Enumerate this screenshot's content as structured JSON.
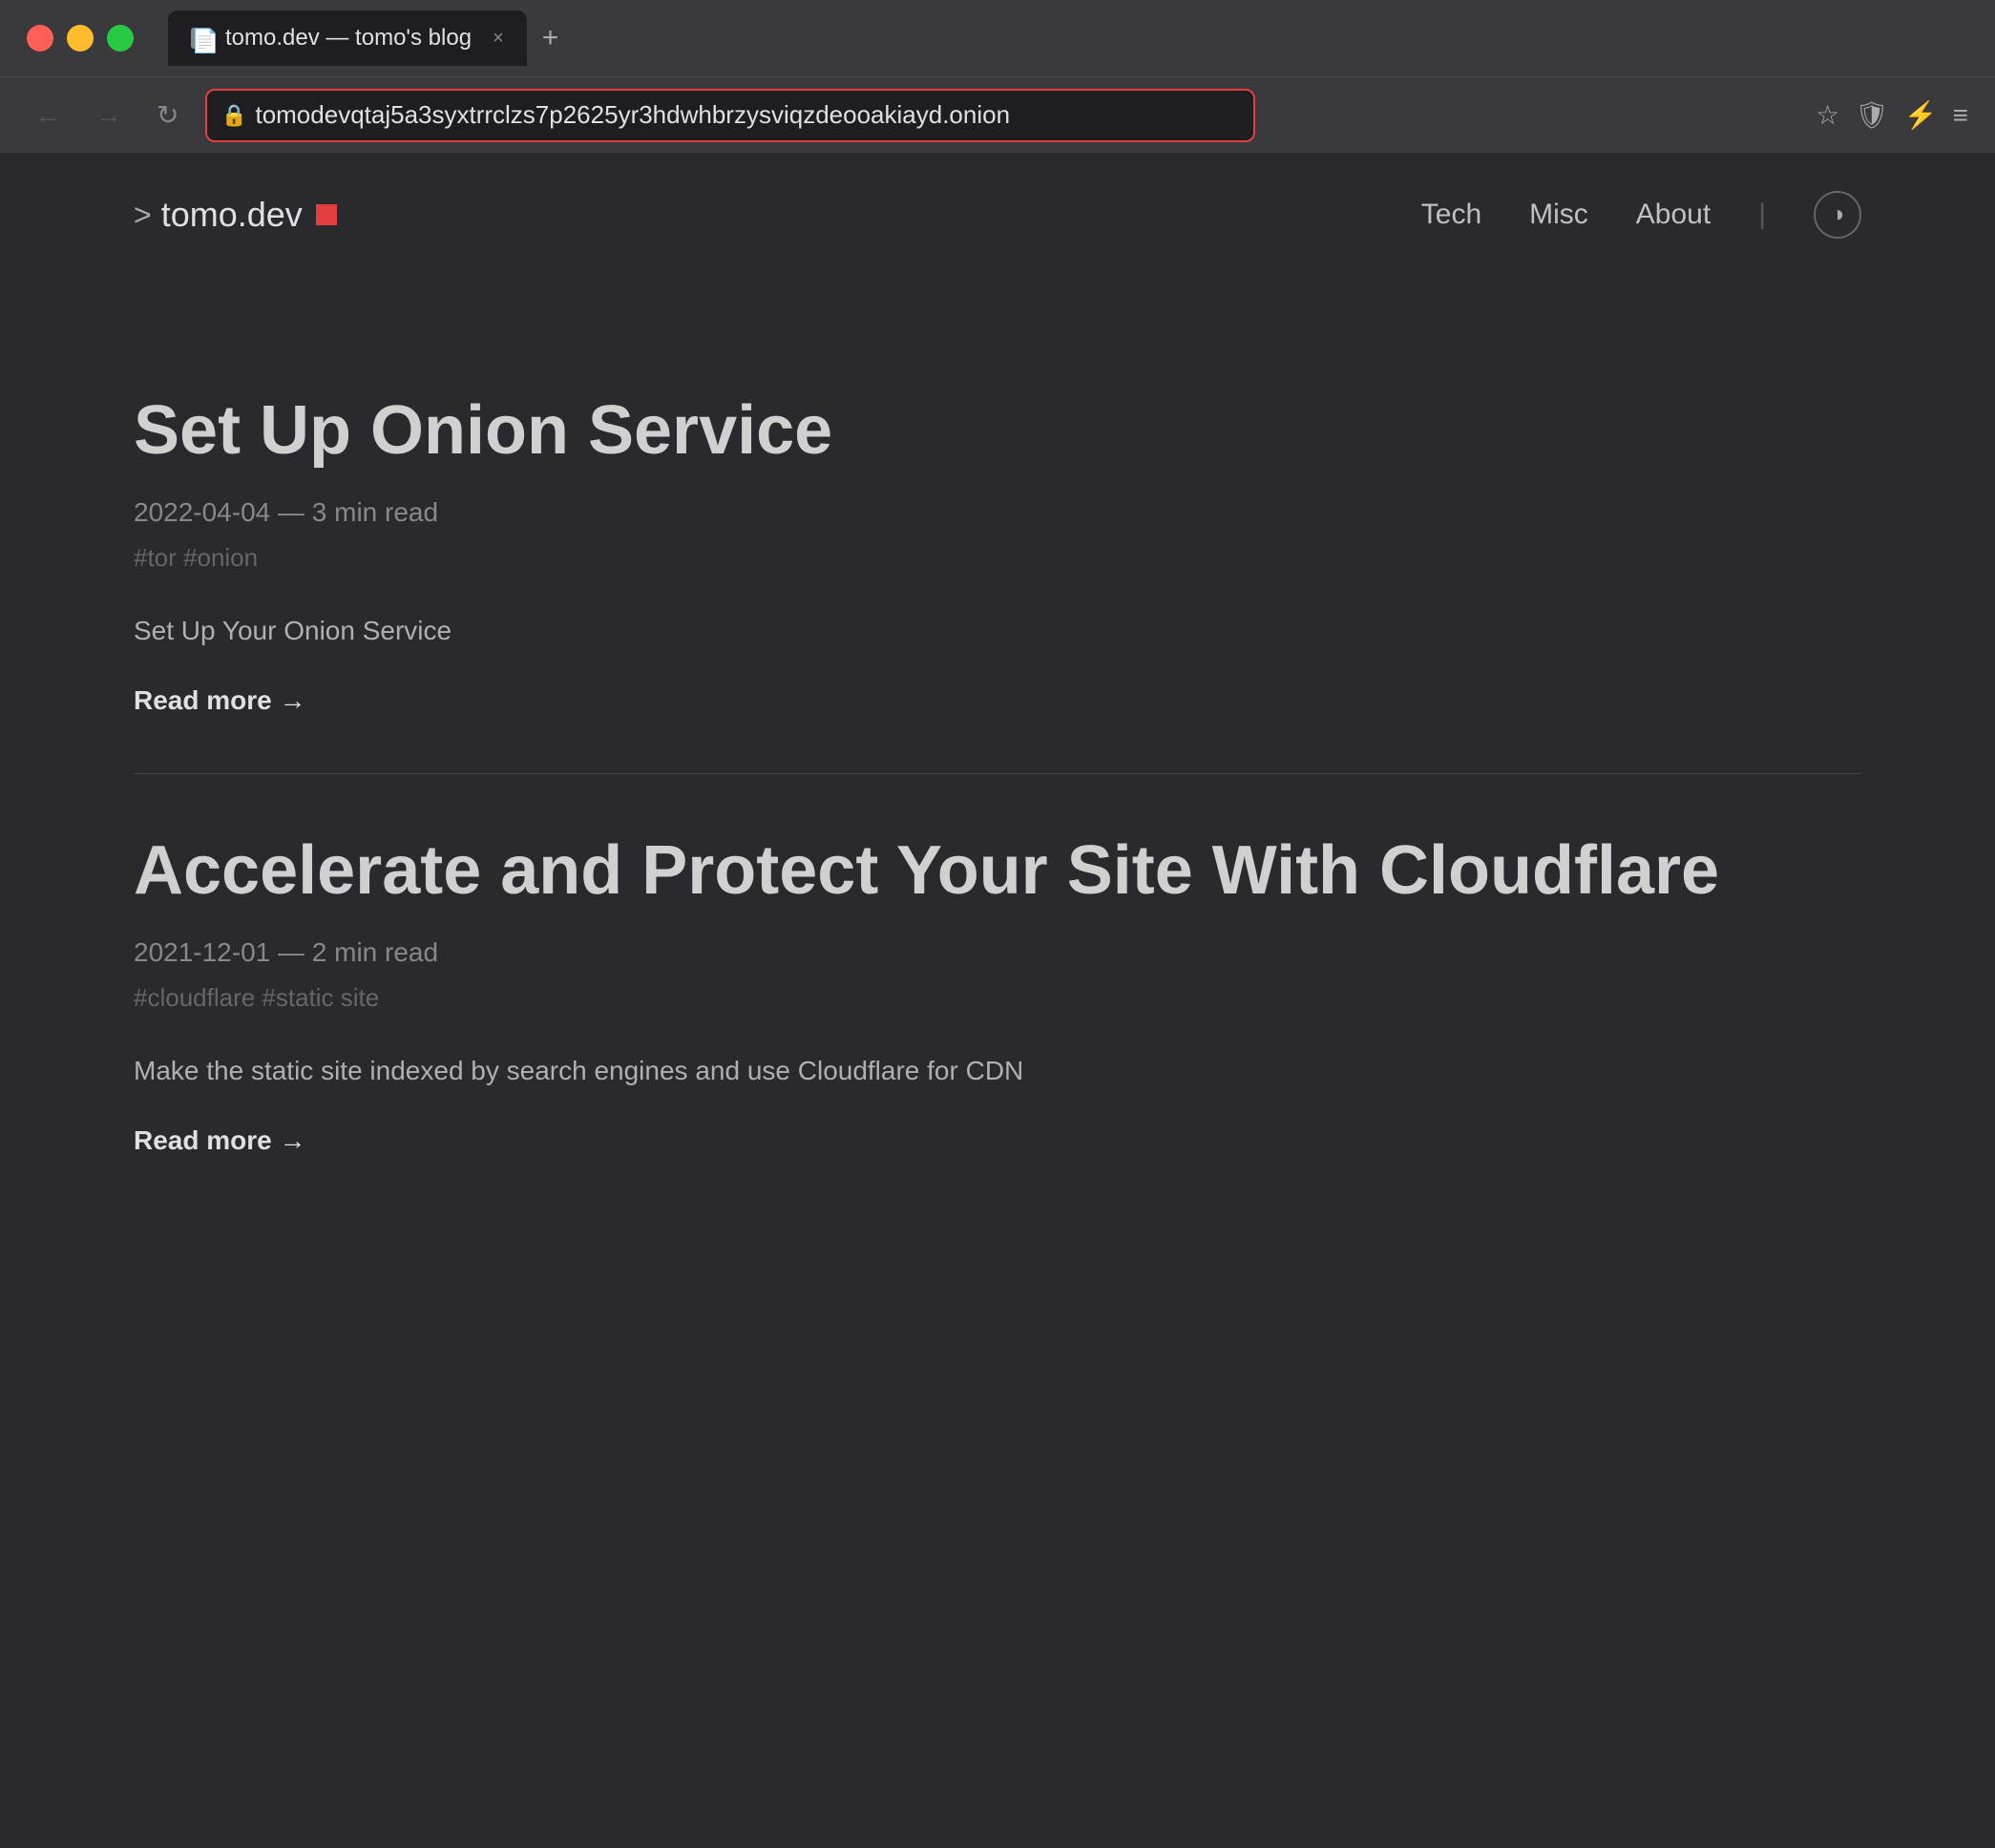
{
  "browser": {
    "tab_title": "tomo.dev — tomo's blog",
    "tab_close": "×",
    "tab_new": "+",
    "address": "tomodevqtaj5a3syxtrrclzs7p2625yr3hdwhbrzysviqzdeooakiayd.onion",
    "address_icon": "🔒",
    "nav_back": "←",
    "nav_forward": "→",
    "nav_refresh": "↻",
    "action_bookmark": "☆",
    "action_shield": "🛡",
    "action_extension": "⚡",
    "action_menu": "≡"
  },
  "site": {
    "logo_chevron": ">",
    "logo_name": "tomo.dev",
    "nav_tech": "Tech",
    "nav_misc": "Misc",
    "nav_about": "About",
    "theme_icon": "◑"
  },
  "posts": [
    {
      "title": "Set Up Onion Service",
      "meta": "2022-04-04 — 3 min read",
      "tags": "#tor  #onion",
      "excerpt": "Set Up Your Onion Service",
      "read_more": "Read more →"
    },
    {
      "title": "Accelerate and Protect Your Site With Cloudflare",
      "meta": "2021-12-01 — 2 min read",
      "tags": "#cloudflare  #static site",
      "excerpt": "Make the static site indexed by search engines and use Cloudflare for CDN",
      "read_more": "Read more →"
    }
  ]
}
